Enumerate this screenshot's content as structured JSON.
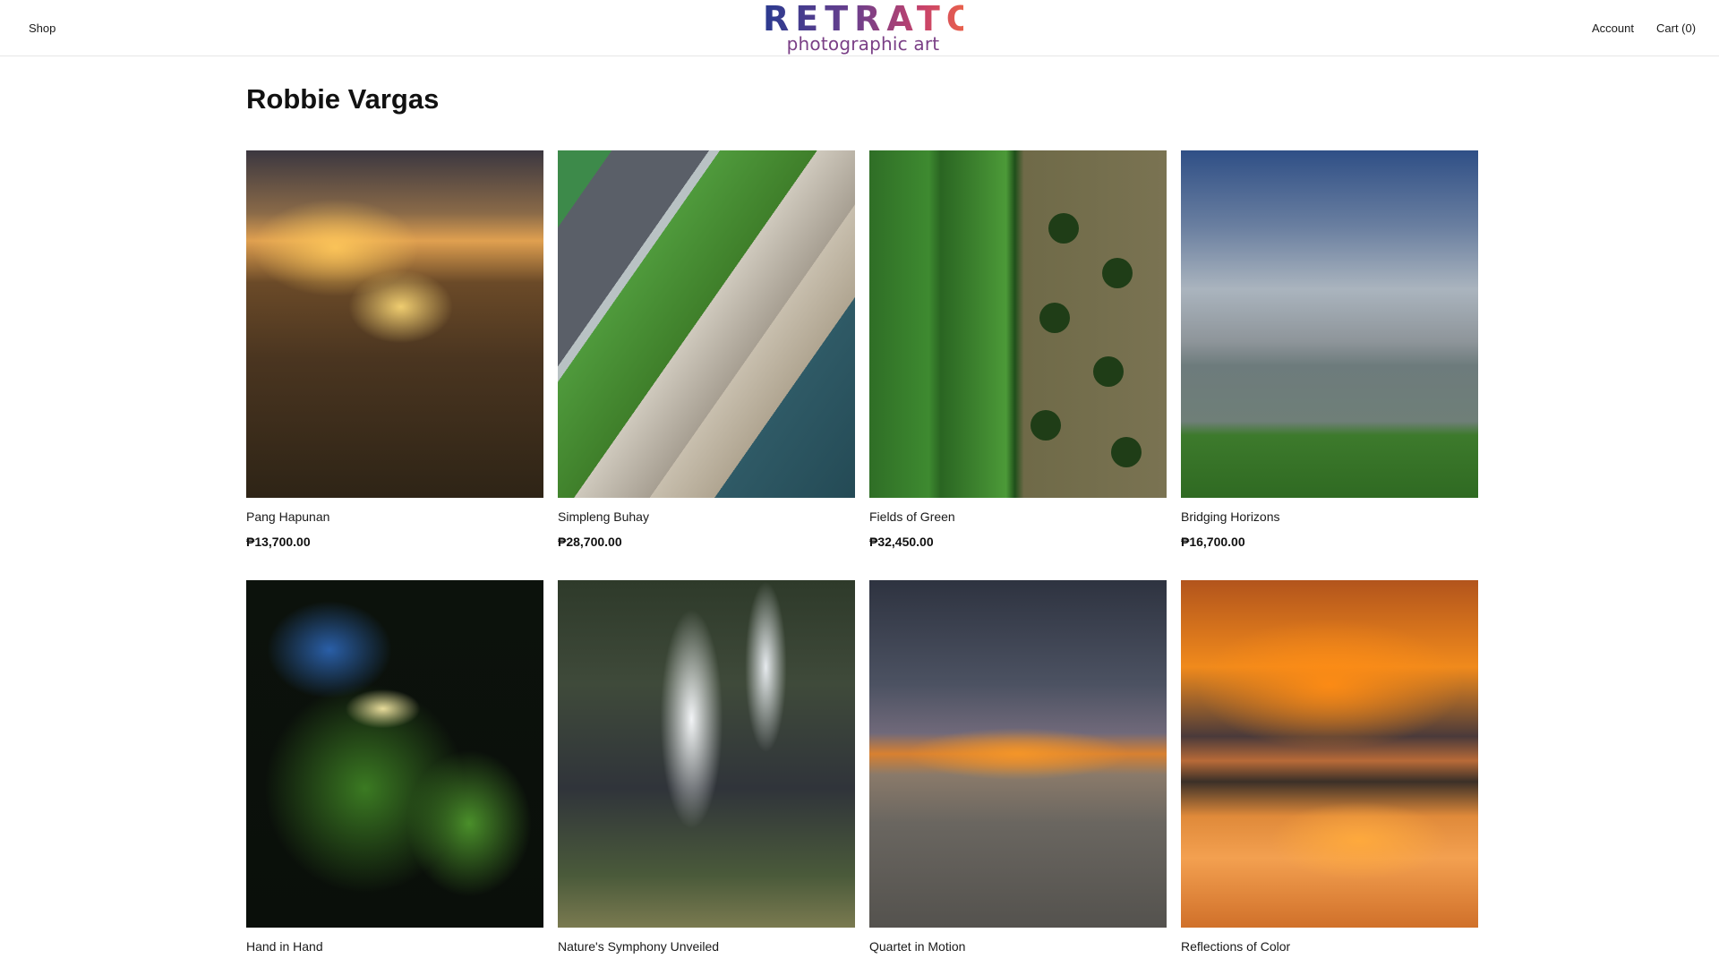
{
  "header": {
    "shop_label": "Shop",
    "logo_word": "RETRATO",
    "logo_tagline": "photographic art",
    "account_label": "Account",
    "cart_label": "Cart (0)"
  },
  "page": {
    "title": "Robbie Vargas"
  },
  "products": [
    {
      "title": "Pang Hapunan",
      "price": "₱13,700.00"
    },
    {
      "title": "Simpleng Buhay",
      "price": "₱28,700.00"
    },
    {
      "title": "Fields of Green",
      "price": "₱32,450.00"
    },
    {
      "title": "Bridging Horizons",
      "price": "₱16,700.00"
    },
    {
      "title": "Hand in Hand",
      "price": ""
    },
    {
      "title": "Nature's Symphony Unveiled",
      "price": ""
    },
    {
      "title": "Quartet in Motion",
      "price": ""
    },
    {
      "title": "Reflections of Color",
      "price": ""
    }
  ],
  "colors": {
    "logo_gradient_start": "#2a3a8f",
    "logo_gradient_end": "#e8604c",
    "tagline": "#7a3f86"
  }
}
